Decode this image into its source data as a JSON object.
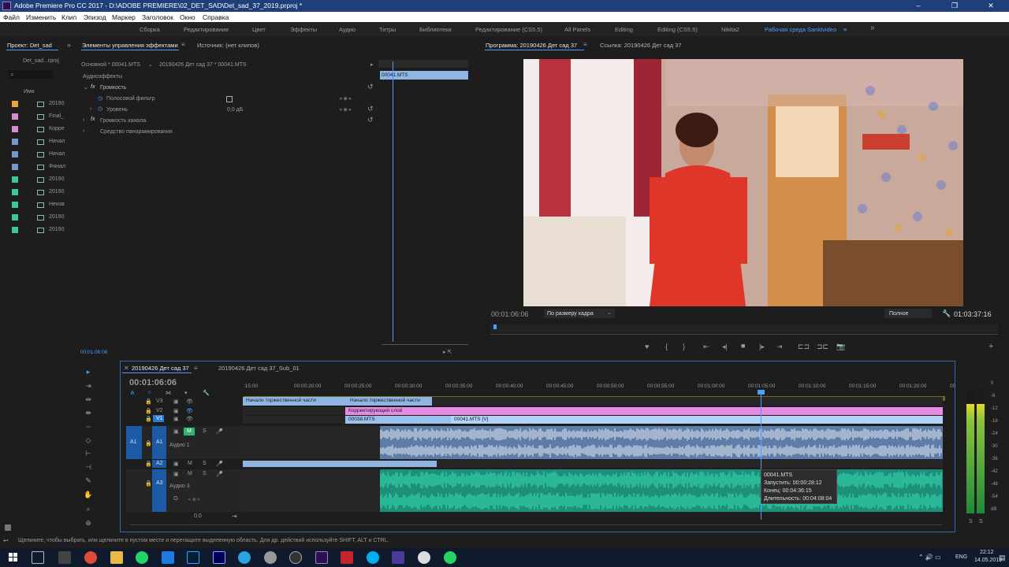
{
  "window": {
    "title": "Adobe Premiere Pro CC 2017 - D:\\ADOBE PREMIERE\\02_DET_SAD\\Det_sad_37_2019.prproj *",
    "controls": [
      "–",
      "❐",
      "✕"
    ]
  },
  "menu": [
    "Файл",
    "Изменить",
    "Клип",
    "Эпизод",
    "Маркер",
    "Заголовок",
    "Окно",
    "Справка"
  ],
  "workspaces": {
    "items": [
      "Сборка",
      "Редактирование",
      "Цвет",
      "Эффекты",
      "Аудио",
      "Титры",
      "Библиотеки",
      "Редактирование (CS5.5)",
      "Editing",
      "Editing (CS5.5)",
      "All Panels",
      "Nikita2",
      "Рабочая среда Sanktvideo"
    ],
    "active": "Рабочая среда Sanktvideo",
    "more": "»"
  },
  "project": {
    "tab": "Проект: Det_sad",
    "file": "Det_sad...rproj",
    "col_name": "Имя",
    "items": [
      {
        "label": "20190",
        "color": "#e8a33c"
      },
      {
        "label": "Final_",
        "color": "#d88ad8"
      },
      {
        "label": "Корре",
        "color": "#d88ad8"
      },
      {
        "label": "Начал",
        "color": "#6e9ad1"
      },
      {
        "label": "Начал",
        "color": "#6e9ad1"
      },
      {
        "label": "Финал",
        "color": "#6e9ad1"
      },
      {
        "label": "20190",
        "color": "#3fc88f"
      },
      {
        "label": "20190",
        "color": "#3fc88f"
      },
      {
        "label": "Неизв",
        "color": "#3fc88f"
      },
      {
        "label": "20190",
        "color": "#3fc88f"
      },
      {
        "label": "20190",
        "color": "#3fc88f"
      }
    ]
  },
  "effects": {
    "tab": "Элементы управления эффектами",
    "source_tab": "Источник: (нет клипов)",
    "master": "Основной * 00041.MTS",
    "sequence": "20190426 Дет сад 37 * 00041.MTS",
    "section": "Аудиоэффекты",
    "rows": {
      "volume": "Громкость",
      "bypass": "Полосовой фильтр",
      "level": "Уровень",
      "level_value": "0,0 дБ",
      "channel_volume": "Громкость канала",
      "panner": "Средство панорамирования"
    },
    "mini_clip": "00041.MTS",
    "timecode": "00:01:06:06"
  },
  "program": {
    "tab": "Программа: 20190426 Дет сад 37",
    "ref_tab": "Ссылка: 20190426 Дет сад 37",
    "timecode": "00:01:06:06",
    "fit": "По размеру кадра",
    "quality": "Полное",
    "duration": "01:03:37:16"
  },
  "timeline": {
    "tab": "20190426 Дет сад 37",
    "tab2": "20190426 Дет сад 37_Sub_01",
    "timecode": "00:01:06:06",
    "ruler": [
      ":15:00",
      "00:00:20:00",
      "00:00:25:00",
      "00:00:30:00",
      "00:00:35:00",
      "00:00:40:00",
      "00:00:45:00",
      "00:00:50:00",
      "00:00:55:00",
      "00:01:00:00",
      "00:01:05:00",
      "00:01:10:00",
      "00:01:15:00",
      "00:01:20:00",
      "00"
    ],
    "tracks": {
      "v3": "V3",
      "v2": "V2",
      "v1": "V1",
      "a1src": "A1",
      "a1": "A1",
      "a1name": "Аудио 1",
      "a2": "A2",
      "a3": "A3",
      "a3name": "Аудио 3",
      "m": "M",
      "s": "S",
      "zero": "0,0"
    },
    "clips": {
      "title1": "Начало торжественной части",
      "title2": "Начало торжественной части",
      "adjust": "Корректирующий слой",
      "v38": "00038.MTS",
      "v41": "00041.MTS [V]"
    },
    "tooltip": {
      "name": "00041.MTS",
      "start": "Запустить: 00:00:28:12",
      "end": "Конец: 00:04:36:15",
      "dur": "Длительность: 00:04:08:04"
    }
  },
  "meter": {
    "labels": [
      "0",
      "-6",
      "-12",
      "-18",
      "-24",
      "-30",
      "-36",
      "-42",
      "-48",
      "-54",
      "dB"
    ],
    "solo": [
      "S",
      "S"
    ],
    "level": 0.88
  },
  "status": "Щелкните, чтобы выбрать, или щелкните в пустом месте и перетащите выделенную область. Для др. действий используйте SHIFT, ALT и CTRL.",
  "taskbar": {
    "lang": "ENG",
    "time": "22:12",
    "date": "14.05.2019"
  }
}
